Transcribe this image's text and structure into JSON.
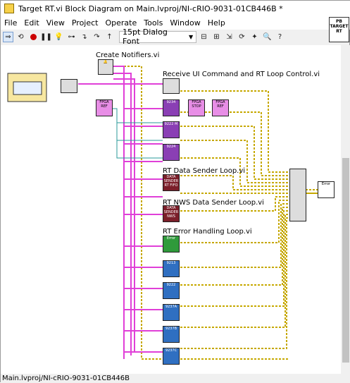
{
  "window": {
    "title": "Target RT.vi Block Diagram on Main.lvproj/NI-cRIO-9031-01CB446B *"
  },
  "menu": [
    "File",
    "Edit",
    "View",
    "Project",
    "Operate",
    "Tools",
    "Window",
    "Help"
  ],
  "toolbar": {
    "font_select": "15pt Dialog Font",
    "buttons": [
      "run-arrow",
      "run-continuous",
      "abort",
      "pause",
      "highlight-execution",
      "retain-wire-values",
      "step-into",
      "step-over",
      "step-out",
      "text-settings",
      "align",
      "distribute",
      "resize",
      "reorder",
      "cleanup",
      "search",
      "context-help"
    ]
  },
  "target_icon": {
    "line1": "PB",
    "line2": "TARGET",
    "line3": "RT"
  },
  "diagram": {
    "labels": {
      "create_notifiers": "Create Notifiers.vi",
      "receive_ui": "Receive UI Command and RT Loop Control.vi",
      "data_sender": "RT Data Sender Loop.vi",
      "nws_sender": "RT NWS Data Sender Loop.vi",
      "error_handling": "RT Error Handling Loop.vi"
    },
    "blocks": {
      "fpga_ref_1": "FPGA REF",
      "fpga_stop": "FPGA STOP",
      "fpga_ref_2": "FPGA REF",
      "b9234": "9234",
      "b9222m": "9222 M",
      "b9224": "9224",
      "data_sender_icon": "DATA SENDER RT FIFO",
      "nws_sender_icon": "DATA SENDER NWS",
      "error_icon": "Error",
      "b9213": "9213",
      "b9222": "9222",
      "b9237a": "9237A",
      "b9237b": "9237B",
      "b9237c": "9237C",
      "error_out": "Error"
    }
  },
  "status_bar": {
    "text": "Main.lvproj/NI-cRIO-9031-01CB446B"
  }
}
